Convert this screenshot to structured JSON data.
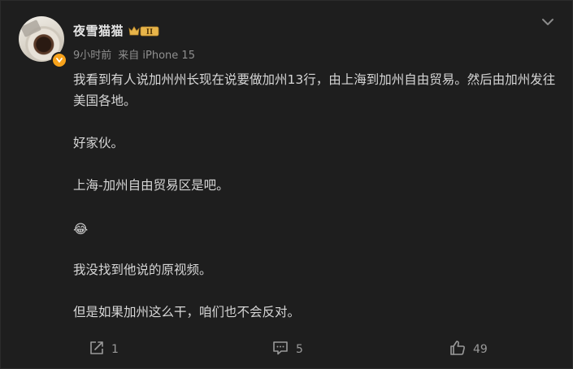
{
  "post": {
    "author": {
      "username": "夜雪猫猫",
      "vip_level": "II",
      "avatar": "coffee-cup-avatar",
      "verified": true
    },
    "meta": {
      "time": "9小时前",
      "source": "来自 iPhone 15"
    },
    "paragraphs": {
      "p1": "我看到有人说加州州长现在说要做加州13行，由上海到加州自由贸易。然后由加州发往美国各地。",
      "p2": "好家伙。",
      "p3": "上海-加州自由贸易区是吧。",
      "p4": "😂",
      "p5": "我没找到他说的原视频。",
      "p6": "但是如果加州这么干，咱们也不会反对。"
    },
    "actions": {
      "repost_count": "1",
      "comment_count": "5",
      "like_count": "49"
    }
  },
  "colors": {
    "background": "#1e1e1e",
    "text": "#d6d6d6",
    "muted": "#8f8f8f",
    "verified_badge": "#f7a21b",
    "vip_gold": "#e8b54a"
  },
  "icons": {
    "more": "chevron-down-icon",
    "repost": "share-icon",
    "comment": "comment-icon",
    "like": "thumbs-up-icon",
    "verified": "verified-badge-icon",
    "vip": "crown-vip-icon"
  }
}
